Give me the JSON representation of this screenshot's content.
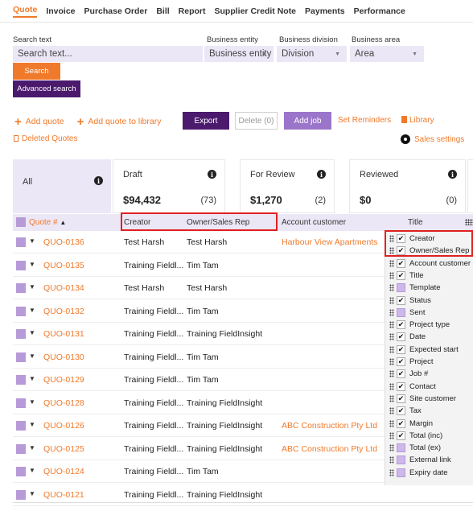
{
  "nav": {
    "tabs": [
      "Quote",
      "Invoice",
      "Purchase Order",
      "Bill",
      "Report",
      "Supplier Credit Note",
      "Payments",
      "Performance"
    ],
    "active": "Quote"
  },
  "filters": {
    "search_label": "Search text",
    "search_placeholder": "Search text...",
    "entity_label": "Business entity",
    "entity_value": "Business entity",
    "division_label": "Business division",
    "division_value": "Division",
    "area_label": "Business area",
    "area_value": "Area"
  },
  "buttons": {
    "search": "Search",
    "advanced": "Advanced search",
    "add_quote": "Add quote",
    "add_quote_library": "Add quote to library",
    "export": "Export",
    "delete": "Delete (0)",
    "add_job": "Add job",
    "set_reminders": "Set Reminders",
    "library": "Library",
    "deleted_quotes": "Deleted Quotes",
    "sales_settings": "Sales settings"
  },
  "cards": [
    {
      "title": "All",
      "amount": "",
      "count": ""
    },
    {
      "title": "Draft",
      "amount": "$94,432",
      "count": "(73)"
    },
    {
      "title": "For Review",
      "amount": "$1,270",
      "count": "(2)"
    },
    {
      "title": "Reviewed",
      "amount": "$0",
      "count": "(0)"
    },
    {
      "title": "A",
      "amount": "$",
      "count": ""
    }
  ],
  "table": {
    "headers": {
      "quote": "Quote #",
      "creator": "Creator",
      "owner": "Owner/Sales Rep",
      "account": "Account customer",
      "title": "Title"
    },
    "rows": [
      {
        "quote": "QUO-0136",
        "creator": "Test Harsh",
        "owner": "Test Harsh",
        "account": "Harbour View Apartments"
      },
      {
        "quote": "QUO-0135",
        "creator": "Training Fieldl...",
        "owner": "Tim Tam",
        "account": ""
      },
      {
        "quote": "QUO-0134",
        "creator": "Test Harsh",
        "owner": "Test Harsh",
        "account": ""
      },
      {
        "quote": "QUO-0132",
        "creator": "Training Fieldl...",
        "owner": "Tim Tam",
        "account": ""
      },
      {
        "quote": "QUO-0131",
        "creator": "Training Fieldl...",
        "owner": "Training FieldInsight",
        "account": ""
      },
      {
        "quote": "QUO-0130",
        "creator": "Training Fieldl...",
        "owner": "Tim Tam",
        "account": ""
      },
      {
        "quote": "QUO-0129",
        "creator": "Training Fieldl...",
        "owner": "Tim Tam",
        "account": ""
      },
      {
        "quote": "QUO-0128",
        "creator": "Training Fieldl...",
        "owner": "Training FieldInsight",
        "account": ""
      },
      {
        "quote": "QUO-0126",
        "creator": "Training Fieldl...",
        "owner": "Training FieldInsight",
        "account": "ABC Construction Pty Ltd"
      },
      {
        "quote": "QUO-0125",
        "creator": "Training Fieldl...",
        "owner": "Training FieldInsight",
        "account": "ABC Construction Pty Ltd"
      },
      {
        "quote": "QUO-0124",
        "creator": "Training Fieldl...",
        "owner": "Tim Tam",
        "account": ""
      },
      {
        "quote": "QUO-0121",
        "creator": "Training Fieldl...",
        "owner": "Training FieldInsight",
        "account": ""
      }
    ]
  },
  "columns": [
    {
      "label": "Creator",
      "checked": true
    },
    {
      "label": "Owner/Sales Rep",
      "checked": true
    },
    {
      "label": "Account customer",
      "checked": true
    },
    {
      "label": "Title",
      "checked": true
    },
    {
      "label": "Template",
      "checked": false
    },
    {
      "label": "Status",
      "checked": true
    },
    {
      "label": "Sent",
      "checked": false
    },
    {
      "label": "Project type",
      "checked": true
    },
    {
      "label": "Date",
      "checked": true
    },
    {
      "label": "Expected start",
      "checked": true
    },
    {
      "label": "Project",
      "checked": true
    },
    {
      "label": "Job #",
      "checked": true
    },
    {
      "label": "Contact",
      "checked": true
    },
    {
      "label": "Site customer",
      "checked": true
    },
    {
      "label": "Tax",
      "checked": true
    },
    {
      "label": "Margin",
      "checked": true
    },
    {
      "label": "Total (inc)",
      "checked": true
    },
    {
      "label": "Total (ex)",
      "checked": false
    },
    {
      "label": "External link",
      "checked": false
    },
    {
      "label": "Expiry date",
      "checked": false
    }
  ],
  "colors": {
    "orange": "#f07a2b",
    "purple": "#4b1a6d",
    "lilac": "#ece7f6",
    "highlight": "#e02020"
  }
}
